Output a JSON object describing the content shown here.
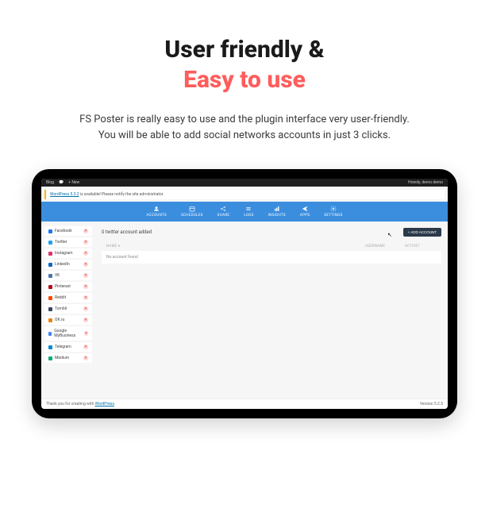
{
  "hero": {
    "title_line1": "User friendly &",
    "title_line2": "Easy to use",
    "desc_line1": "FS Poster is really easy to use and the plugin interface very user-friendly.",
    "desc_line2": "You will be able to add social networks accounts in just 3 clicks."
  },
  "adminbar": {
    "blog": "Blog",
    "new": "New",
    "howdy": "Howdy, demo demo"
  },
  "notice": {
    "link": "WordPress 5.3.2",
    "text": " is available! Please notify the site administrator."
  },
  "nav": {
    "items": [
      {
        "label": "ACCOUNTS"
      },
      {
        "label": "SCHEDULES"
      },
      {
        "label": "SHARE"
      },
      {
        "label": "LOGS"
      },
      {
        "label": "INSIGHTS"
      },
      {
        "label": "APPS"
      },
      {
        "label": "SETTINGS"
      }
    ]
  },
  "sidebar": {
    "items": [
      {
        "name": "Facebook",
        "color": "#1877f2"
      },
      {
        "name": "Twitter",
        "color": "#1da1f2"
      },
      {
        "name": "Instagram",
        "color": "#e1306c"
      },
      {
        "name": "LinkedIn",
        "color": "#0a66c2"
      },
      {
        "name": "VK",
        "color": "#4a76a8"
      },
      {
        "name": "Pinterest",
        "color": "#bd081c"
      },
      {
        "name": "Reddit",
        "color": "#ff4500"
      },
      {
        "name": "Tumblr",
        "color": "#35465c"
      },
      {
        "name": "OK.ru",
        "color": "#ee8208"
      },
      {
        "name": "Google MyBusiness",
        "color": "#4285f4"
      },
      {
        "name": "Telegram",
        "color": "#0088cc"
      },
      {
        "name": "Medium",
        "color": "#00ab6c"
      }
    ]
  },
  "main": {
    "heading": "0 twitter account added",
    "add_button": "+ ADD ACCOUNT",
    "columns": {
      "name": "NAME ▾",
      "username": "USERNAME",
      "active": "ACTIVE?"
    },
    "empty": "No account found"
  },
  "footer": {
    "thanks_prefix": "Thank you for creating with ",
    "thanks_link": "WordPress",
    "version": "Version 5.2.5"
  }
}
